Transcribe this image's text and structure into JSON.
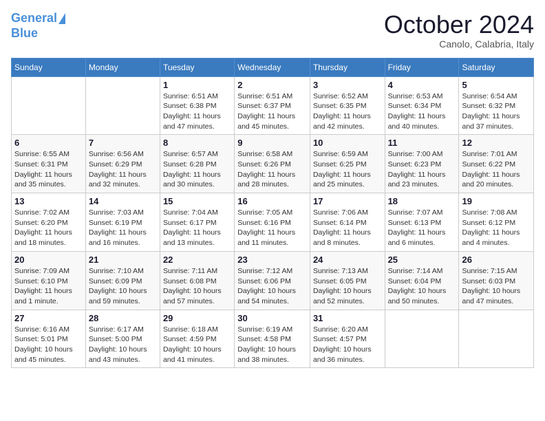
{
  "header": {
    "logo_line1": "General",
    "logo_line2": "Blue",
    "month_title": "October 2024",
    "subtitle": "Canolo, Calabria, Italy"
  },
  "days_of_week": [
    "Sunday",
    "Monday",
    "Tuesday",
    "Wednesday",
    "Thursday",
    "Friday",
    "Saturday"
  ],
  "weeks": [
    [
      {
        "day": "",
        "info": ""
      },
      {
        "day": "",
        "info": ""
      },
      {
        "day": "1",
        "info": "Sunrise: 6:51 AM\nSunset: 6:38 PM\nDaylight: 11 hours and 47 minutes."
      },
      {
        "day": "2",
        "info": "Sunrise: 6:51 AM\nSunset: 6:37 PM\nDaylight: 11 hours and 45 minutes."
      },
      {
        "day": "3",
        "info": "Sunrise: 6:52 AM\nSunset: 6:35 PM\nDaylight: 11 hours and 42 minutes."
      },
      {
        "day": "4",
        "info": "Sunrise: 6:53 AM\nSunset: 6:34 PM\nDaylight: 11 hours and 40 minutes."
      },
      {
        "day": "5",
        "info": "Sunrise: 6:54 AM\nSunset: 6:32 PM\nDaylight: 11 hours and 37 minutes."
      }
    ],
    [
      {
        "day": "6",
        "info": "Sunrise: 6:55 AM\nSunset: 6:31 PM\nDaylight: 11 hours and 35 minutes."
      },
      {
        "day": "7",
        "info": "Sunrise: 6:56 AM\nSunset: 6:29 PM\nDaylight: 11 hours and 32 minutes."
      },
      {
        "day": "8",
        "info": "Sunrise: 6:57 AM\nSunset: 6:28 PM\nDaylight: 11 hours and 30 minutes."
      },
      {
        "day": "9",
        "info": "Sunrise: 6:58 AM\nSunset: 6:26 PM\nDaylight: 11 hours and 28 minutes."
      },
      {
        "day": "10",
        "info": "Sunrise: 6:59 AM\nSunset: 6:25 PM\nDaylight: 11 hours and 25 minutes."
      },
      {
        "day": "11",
        "info": "Sunrise: 7:00 AM\nSunset: 6:23 PM\nDaylight: 11 hours and 23 minutes."
      },
      {
        "day": "12",
        "info": "Sunrise: 7:01 AM\nSunset: 6:22 PM\nDaylight: 11 hours and 20 minutes."
      }
    ],
    [
      {
        "day": "13",
        "info": "Sunrise: 7:02 AM\nSunset: 6:20 PM\nDaylight: 11 hours and 18 minutes."
      },
      {
        "day": "14",
        "info": "Sunrise: 7:03 AM\nSunset: 6:19 PM\nDaylight: 11 hours and 16 minutes."
      },
      {
        "day": "15",
        "info": "Sunrise: 7:04 AM\nSunset: 6:17 PM\nDaylight: 11 hours and 13 minutes."
      },
      {
        "day": "16",
        "info": "Sunrise: 7:05 AM\nSunset: 6:16 PM\nDaylight: 11 hours and 11 minutes."
      },
      {
        "day": "17",
        "info": "Sunrise: 7:06 AM\nSunset: 6:14 PM\nDaylight: 11 hours and 8 minutes."
      },
      {
        "day": "18",
        "info": "Sunrise: 7:07 AM\nSunset: 6:13 PM\nDaylight: 11 hours and 6 minutes."
      },
      {
        "day": "19",
        "info": "Sunrise: 7:08 AM\nSunset: 6:12 PM\nDaylight: 11 hours and 4 minutes."
      }
    ],
    [
      {
        "day": "20",
        "info": "Sunrise: 7:09 AM\nSunset: 6:10 PM\nDaylight: 11 hours and 1 minute."
      },
      {
        "day": "21",
        "info": "Sunrise: 7:10 AM\nSunset: 6:09 PM\nDaylight: 10 hours and 59 minutes."
      },
      {
        "day": "22",
        "info": "Sunrise: 7:11 AM\nSunset: 6:08 PM\nDaylight: 10 hours and 57 minutes."
      },
      {
        "day": "23",
        "info": "Sunrise: 7:12 AM\nSunset: 6:06 PM\nDaylight: 10 hours and 54 minutes."
      },
      {
        "day": "24",
        "info": "Sunrise: 7:13 AM\nSunset: 6:05 PM\nDaylight: 10 hours and 52 minutes."
      },
      {
        "day": "25",
        "info": "Sunrise: 7:14 AM\nSunset: 6:04 PM\nDaylight: 10 hours and 50 minutes."
      },
      {
        "day": "26",
        "info": "Sunrise: 7:15 AM\nSunset: 6:03 PM\nDaylight: 10 hours and 47 minutes."
      }
    ],
    [
      {
        "day": "27",
        "info": "Sunrise: 6:16 AM\nSunset: 5:01 PM\nDaylight: 10 hours and 45 minutes."
      },
      {
        "day": "28",
        "info": "Sunrise: 6:17 AM\nSunset: 5:00 PM\nDaylight: 10 hours and 43 minutes."
      },
      {
        "day": "29",
        "info": "Sunrise: 6:18 AM\nSunset: 4:59 PM\nDaylight: 10 hours and 41 minutes."
      },
      {
        "day": "30",
        "info": "Sunrise: 6:19 AM\nSunset: 4:58 PM\nDaylight: 10 hours and 38 minutes."
      },
      {
        "day": "31",
        "info": "Sunrise: 6:20 AM\nSunset: 4:57 PM\nDaylight: 10 hours and 36 minutes."
      },
      {
        "day": "",
        "info": ""
      },
      {
        "day": "",
        "info": ""
      }
    ]
  ]
}
